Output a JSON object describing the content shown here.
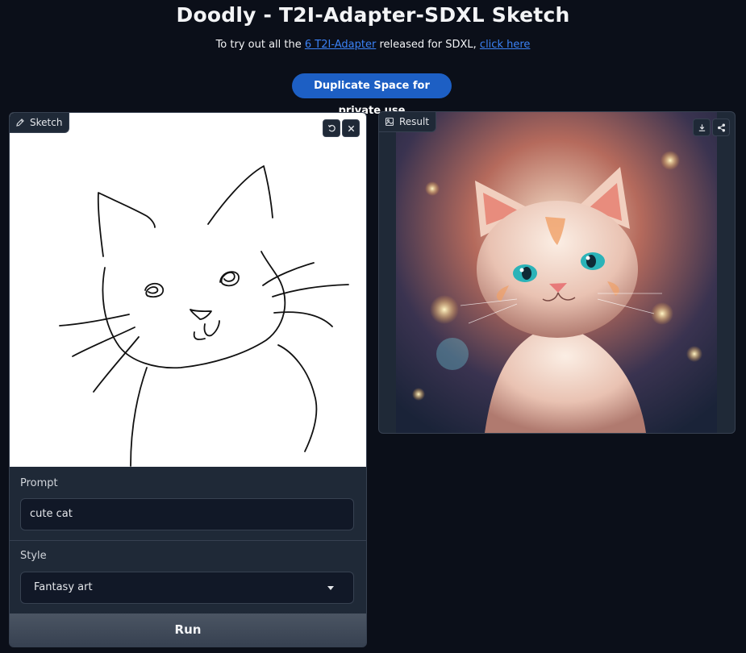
{
  "header": {
    "title": "Doodly - T2I-Adapter-SDXL Sketch",
    "subtitle_before": "To try out all the ",
    "subtitle_link1": "6 T2I-Adapter",
    "subtitle_middle": " released for SDXL, ",
    "subtitle_link2": "click here",
    "duplicate_label": "Duplicate Space for private use"
  },
  "sketch_panel": {
    "tag_label": "Sketch",
    "tag_icon": "pencil-icon",
    "undo_icon": "undo-icon",
    "clear_icon": "close-icon"
  },
  "prompt": {
    "label": "Prompt",
    "value": "cute cat"
  },
  "style": {
    "label": "Style",
    "value": "Fantasy art"
  },
  "run": {
    "label": "Run"
  },
  "result_panel": {
    "tag_label": "Result",
    "tag_icon": "image-icon",
    "download_icon": "download-icon",
    "share_icon": "share-icon"
  },
  "colors": {
    "background": "#0b0f19",
    "panel": "#1f2937",
    "accent_button": "#1d5fc4",
    "link": "#3b82f6"
  }
}
